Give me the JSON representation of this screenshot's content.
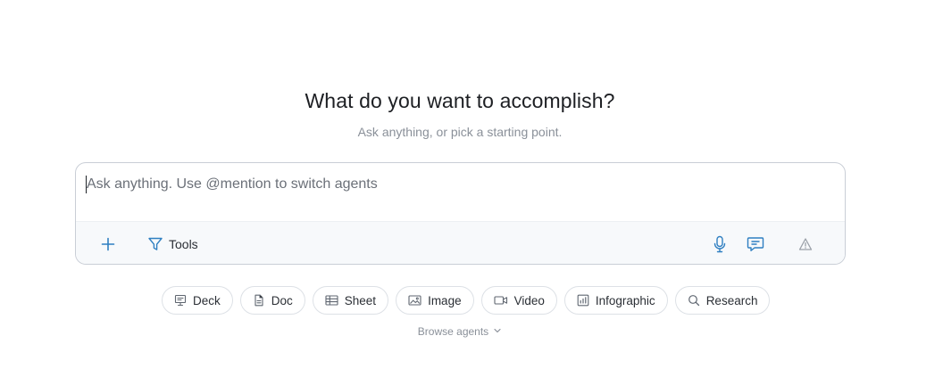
{
  "hero": {
    "title": "What do you want to accomplish?",
    "subtitle": "Ask anything, or pick a starting point."
  },
  "composer": {
    "placeholder": "Ask anything. Use @mention to switch agents",
    "value": "",
    "toolbar": {
      "add_icon": "plus-icon",
      "tools_label": "Tools",
      "tools_icon": "filter-icon",
      "mic_icon": "microphone-icon",
      "chat_icon": "chat-bubble-icon",
      "model_icon": "warning-triangle-icon"
    }
  },
  "chips": [
    {
      "label": "Deck",
      "icon": "presentation-icon"
    },
    {
      "label": "Doc",
      "icon": "document-icon"
    },
    {
      "label": "Sheet",
      "icon": "table-icon"
    },
    {
      "label": "Image",
      "icon": "image-icon"
    },
    {
      "label": "Video",
      "icon": "video-camera-icon"
    },
    {
      "label": "Infographic",
      "icon": "chart-icon"
    },
    {
      "label": "Research",
      "icon": "search-icon"
    }
  ],
  "browse": {
    "label": "Browse agents",
    "icon": "chevron-down-icon"
  },
  "colors": {
    "accent": "#2f7fc1",
    "muted_text": "#8a9099",
    "border": "#c9ced6",
    "toolbar_bg": "#f7f9fb"
  }
}
